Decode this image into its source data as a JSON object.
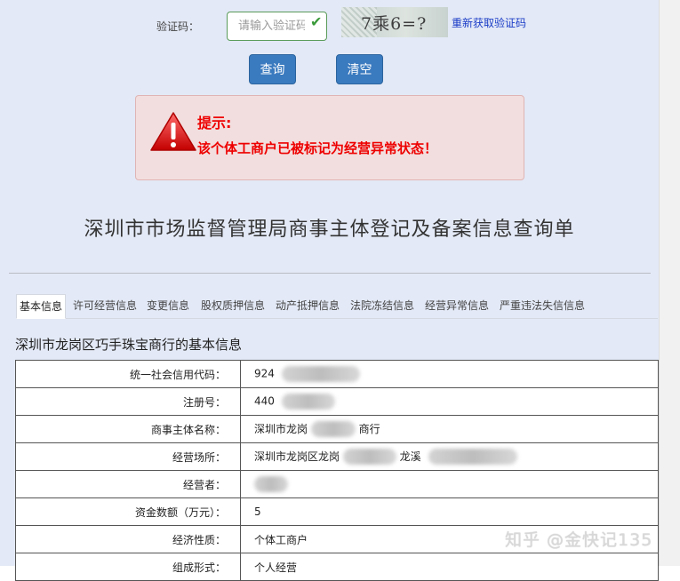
{
  "captcha": {
    "label": "验证码：",
    "placeholder": "请输入验证码",
    "image_text": "7乘6=?",
    "refresh_link": "重新获取验证码"
  },
  "buttons": {
    "query": "查询",
    "clear": "清空"
  },
  "alert": {
    "title": "提示:",
    "message": "该个体工商户已被标记为经营异常状态！"
  },
  "page_title": "深圳市市场监督管理局商事主体登记及备案信息查询单",
  "tabs": [
    {
      "label": "基本信息",
      "active": true
    },
    {
      "label": "许可经营信息",
      "active": false
    },
    {
      "label": "变更信息",
      "active": false
    },
    {
      "label": "股权质押信息",
      "active": false
    },
    {
      "label": "动产抵押信息",
      "active": false
    },
    {
      "label": "法院冻结信息",
      "active": false
    },
    {
      "label": "经营异常信息",
      "active": false
    },
    {
      "label": "严重违法失信信息",
      "active": false
    }
  ],
  "section_title": "深圳市龙岗区巧手珠宝商行的基本信息",
  "table": {
    "rows": [
      {
        "label": "统一社会信用代码：",
        "value": "924"
      },
      {
        "label": "注册号：",
        "value": "440"
      },
      {
        "label": "商事主体名称：",
        "value": "深圳市龙岗",
        "value_suffix": "商行"
      },
      {
        "label": "经营场所：",
        "value": "深圳市龙岗区龙岗",
        "value_suffix": "龙溪"
      },
      {
        "label": "经营者：",
        "value": ""
      },
      {
        "label": "资金数额（万元）：",
        "value": "5"
      },
      {
        "label": "经济性质：",
        "value": "个体工商户"
      },
      {
        "label": "组成形式：",
        "value": "个人经营"
      }
    ]
  },
  "watermark": "知乎 @金快记135",
  "colors": {
    "page_background": "#e3e9f6",
    "button": "#3a7abf",
    "alert_background": "#f2dede",
    "alert_text": "#ee0000",
    "link": "#1a3cc7"
  }
}
